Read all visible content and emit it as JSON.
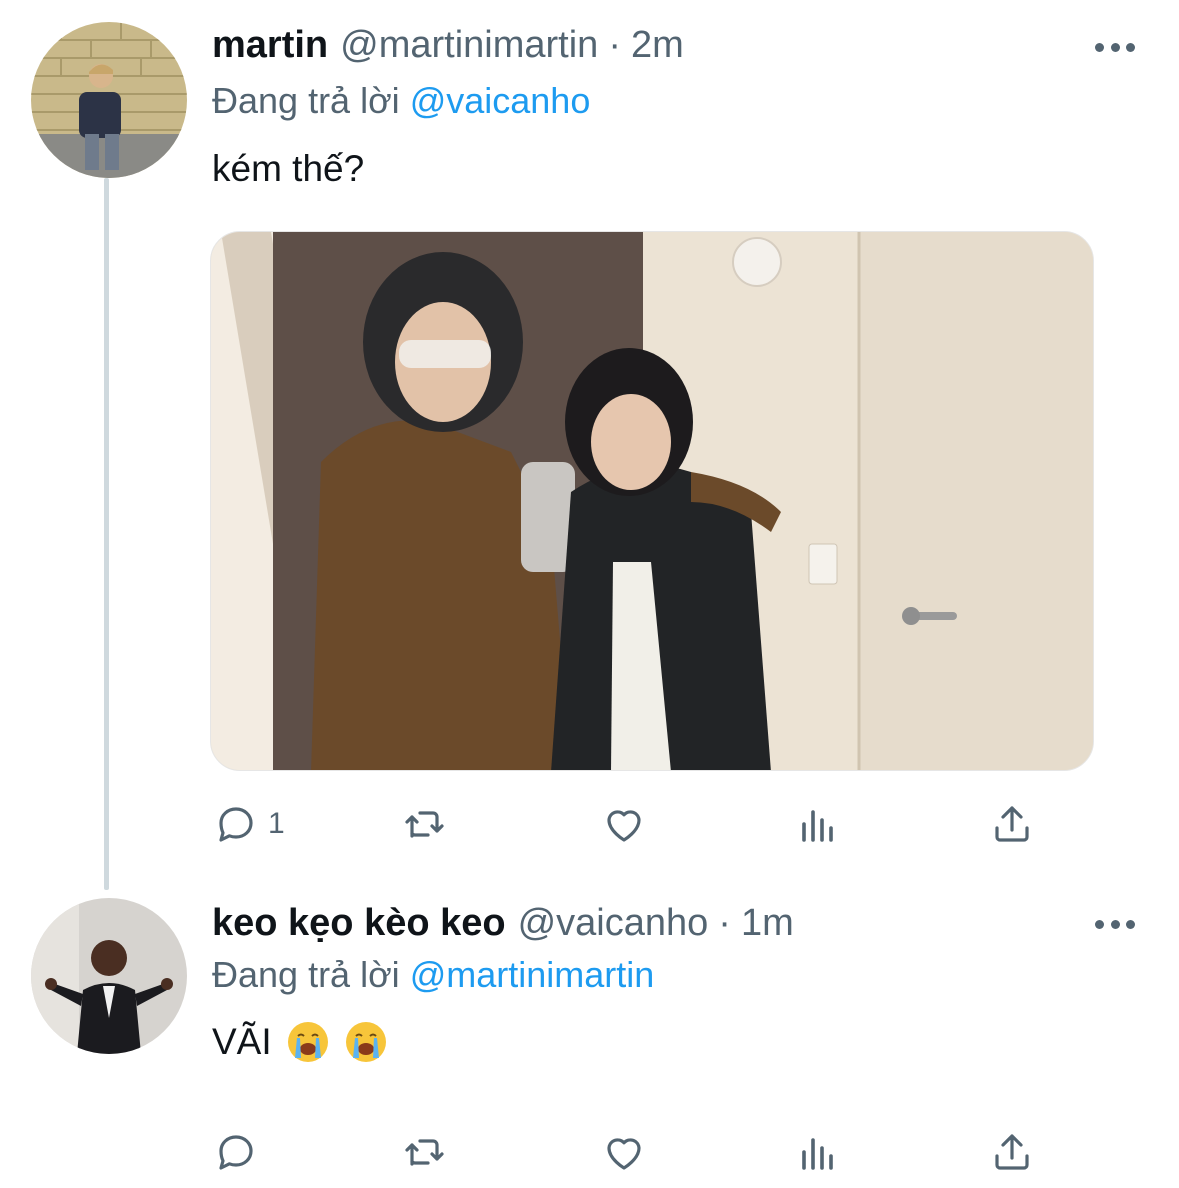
{
  "tweets": [
    {
      "name": "martin",
      "handle": "@martinimartin",
      "separator": "·",
      "time": "2m",
      "replying_prefix": "Đang trả lời",
      "replying_to": "@vaicanho",
      "text": "kém thế?",
      "reply_count": "1",
      "avatar_icon": "user-avatar-photo",
      "has_media": true
    },
    {
      "name": "keo kẹo kèo keo",
      "handle": "@vaicanho",
      "separator": "·",
      "time": "1m",
      "replying_prefix": "Đang trả lời",
      "replying_to": "@martinimartin",
      "text": "VÃI",
      "emoji": [
        "loudly-crying-face",
        "loudly-crying-face"
      ],
      "reply_count": "",
      "avatar_icon": "user-avatar-photo",
      "has_media": false
    }
  ],
  "icons": {
    "reply": "reply-icon",
    "retweet": "retweet-icon",
    "like": "heart-icon",
    "views": "views-icon",
    "share": "share-icon",
    "more": "more-icon"
  },
  "colors": {
    "link": "#1d9bf0",
    "secondary": "#536471",
    "text": "#0f1419",
    "thread_line": "#cfd9de"
  }
}
